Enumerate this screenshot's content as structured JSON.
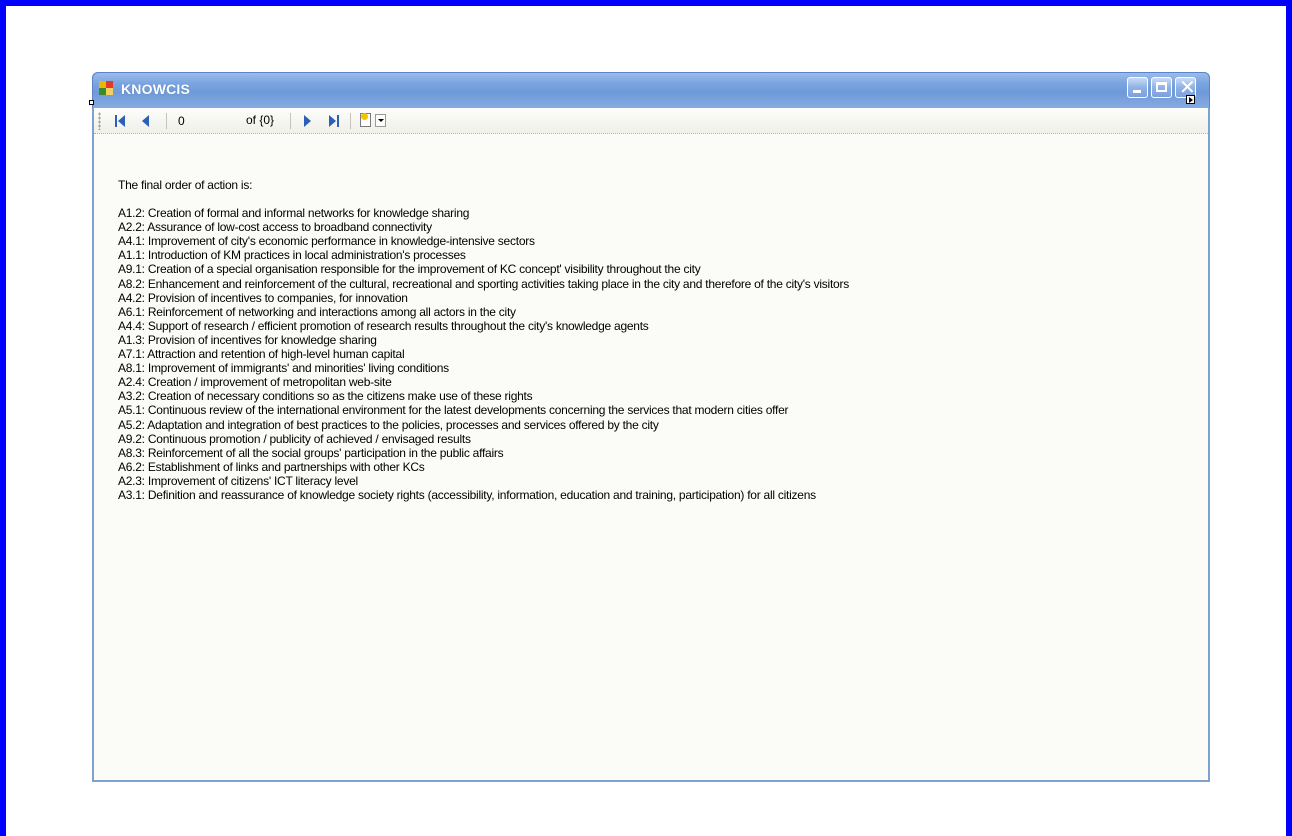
{
  "window": {
    "title": "KNOWCIS"
  },
  "toolbar": {
    "position_value": "0",
    "count_label": "of {0}",
    "buttons": [
      "move-first",
      "move-previous",
      "move-next",
      "move-last",
      "add-new"
    ]
  },
  "main": {
    "intro": "The final order of action is:",
    "actions": [
      "A1.2: Creation of formal and informal networks for knowledge sharing",
      "A2.2: Assurance of low-cost access to broadband connectivity",
      "A4.1: Improvement of city's economic performance in knowledge-intensive sectors",
      "A1.1: Introduction of KM practices in local administration's processes",
      "A9.1: Creation of a special organisation responsible for the improvement of KC concept' visibility throughout the city",
      "A8.2: Enhancement and reinforcement of the cultural, recreational and sporting activities taking place in the city and therefore of the city's visitors",
      "A4.2: Provision of incentives to companies, for innovation",
      "A6.1: Reinforcement of networking and interactions among all actors in the city",
      "A4.4: Support of research / efficient promotion of research results throughout the city's knowledge agents",
      "A1.3: Provision of incentives for knowledge sharing",
      "A7.1: Attraction and retention of high-level human capital",
      "A8.1: Improvement of immigrants' and minorities' living conditions",
      "A2.4: Creation / improvement of metropolitan web-site",
      "A3.2: Creation of necessary conditions so as the citizens make use of these rights",
      "A5.1: Continuous review of the international environment for the latest developments concerning the services that modern cities offer",
      "A5.2: Adaptation and integration of best practices to the policies, processes and services offered by the city",
      "A9.2: Continuous promotion / publicity of achieved / envisaged results",
      "A8.3: Reinforcement of all the social groups' participation in the public affairs",
      "A6.2: Establishment of links and partnerships with other KCs",
      "A2.3: Improvement of citizens' ICT literacy level",
      "A3.1: Definition and reassurance of knowledge society rights (accessibility, information, education and training, participation) for all citizens"
    ]
  },
  "colors": {
    "outer_border": "#0000ff",
    "titlebar": "#7aa4e0",
    "nav_icon": "#2b5fb8"
  }
}
